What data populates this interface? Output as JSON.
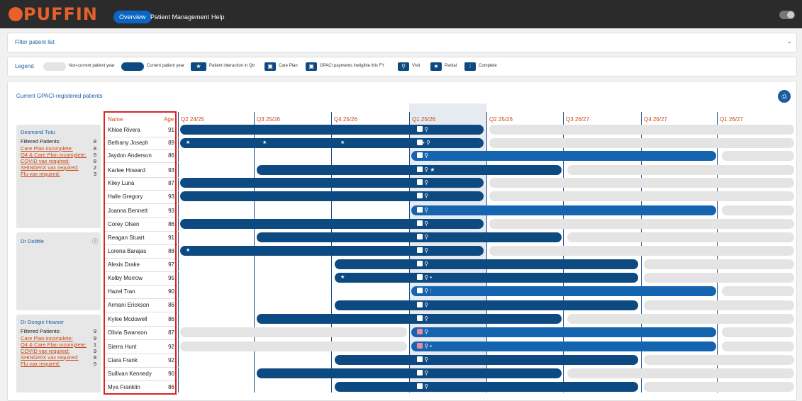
{
  "app": {
    "logo": "PUFFIN"
  },
  "nav": {
    "overview": "Overview",
    "patient_management": "Patient Management",
    "help": "Help"
  },
  "filter": {
    "label": "Filter patient list"
  },
  "legend": {
    "title": "Legend",
    "non_current": "Non-current patient year",
    "current": "Current patient year",
    "interaction": "Patient interaction in Qtr",
    "care_plan": "Care Plan",
    "gpaci": "GPACI payments ineligible this FY",
    "visit": "Visit",
    "partial": "Partial",
    "complete": "Complete"
  },
  "main": {
    "title": "Current GPACI-registered patients"
  },
  "columns": {
    "name": "Name",
    "age": "Age"
  },
  "quarters": [
    "Q2 24/25",
    "Q3 25/26",
    "Q4 25/26",
    "Q1 25/26",
    "Q2 25/26",
    "Q3 26/27",
    "Q4 26/27",
    "Q1 26/27"
  ],
  "groups": [
    {
      "name": "Desmond Tutu",
      "filtered_label": "Filtered Patients:",
      "filtered_value": "8",
      "links": [
        {
          "label": "Care Plan incomplete:",
          "value": "8"
        },
        {
          "label": "Q4 & Care Plan incomplete:",
          "value": "5"
        },
        {
          "label": "COVID vax required:",
          "value": "8"
        },
        {
          "label": "SHINGRIX vax required:",
          "value": "2"
        },
        {
          "label": "Flu vax required:",
          "value": "3"
        }
      ]
    },
    {
      "name": "Dr Dolittle"
    },
    {
      "name": "Dr Doogie Howser",
      "filtered_label": "Filtered Patients:",
      "filtered_value": "9",
      "links": [
        {
          "label": "Care Plan incomplete:",
          "value": "9"
        },
        {
          "label": "Q4 & Care Plan incomplete:",
          "value": "1"
        },
        {
          "label": "COVID vax required:",
          "value": "9"
        },
        {
          "label": "SHINGRIX vax required:",
          "value": "8"
        },
        {
          "label": "Flu vax required:",
          "value": "5"
        }
      ]
    }
  ],
  "patients": [
    {
      "name": "Khloe Rivera",
      "age": "91"
    },
    {
      "name": "Bethany Joseph",
      "age": "89"
    },
    {
      "name": "Jaydon Anderson",
      "age": "86"
    },
    {
      "name": "Karlee Howard",
      "age": "93"
    },
    {
      "name": "Kiley Luna",
      "age": "87"
    },
    {
      "name": "Halle Gregory",
      "age": "93"
    },
    {
      "name": "Joanna Bennett",
      "age": "93"
    },
    {
      "name": "Corey Olsen",
      "age": "86"
    },
    {
      "name": "Reagan Stuart",
      "age": "91"
    },
    {
      "name": "Lorena Barajas",
      "age": "88"
    },
    {
      "name": "Alexis Drake",
      "age": "97"
    },
    {
      "name": "Kolby Morrow",
      "age": "95"
    },
    {
      "name": "Hazel Tran",
      "age": "90"
    },
    {
      "name": "Armani Erickson",
      "age": "86"
    },
    {
      "name": "Kylee Mcdowell",
      "age": "86"
    },
    {
      "name": "Olivia Swanson",
      "age": "87"
    },
    {
      "name": "Sierra Hunt",
      "age": "92"
    },
    {
      "name": "Ciara Frank",
      "age": "92"
    },
    {
      "name": "Sullivan Kennedy",
      "age": "90"
    },
    {
      "name": "Mya Franklin",
      "age": "86"
    }
  ],
  "colors": {
    "accent": "#0b66c3",
    "bar_dark": "#0d4a82",
    "bar_current": "#1564b0",
    "bar_grey": "#e4e4e4",
    "link": "#c94a1a",
    "highlight": "#dd2222"
  }
}
